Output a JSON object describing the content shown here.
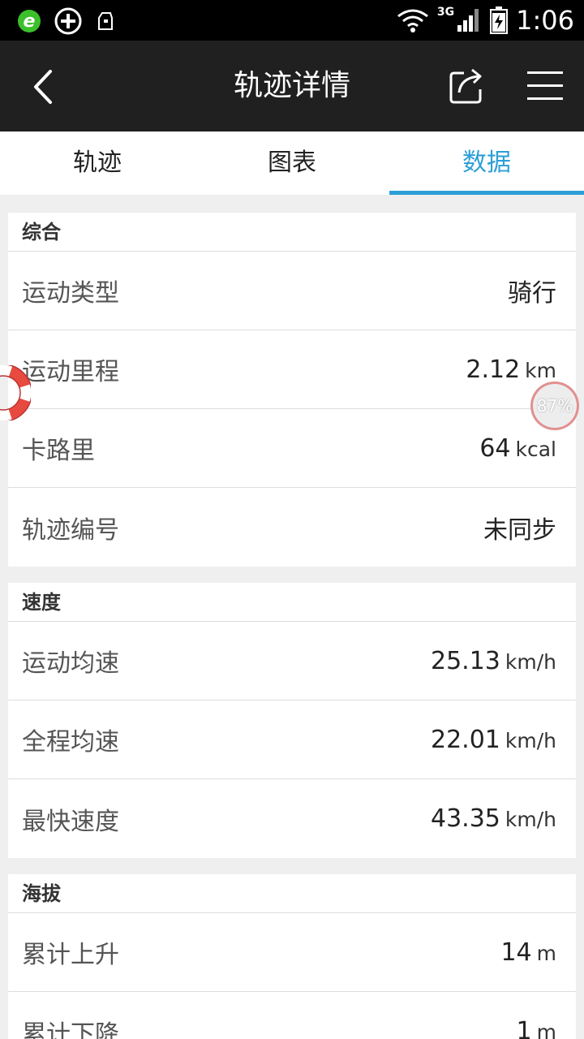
{
  "status_bar": {
    "time": "1:06",
    "network": "3G"
  },
  "app_bar": {
    "title": "轨迹详情"
  },
  "tabs": [
    {
      "label": "轨迹"
    },
    {
      "label": "图表"
    },
    {
      "label": "数据",
      "active": true
    }
  ],
  "sections": {
    "general": {
      "title": "综合",
      "rows": [
        {
          "label": "运动类型",
          "value": "骑行",
          "unit": ""
        },
        {
          "label": "运动里程",
          "value": "2.12",
          "unit": "km"
        },
        {
          "label": "卡路里",
          "value": "64",
          "unit": "kcal"
        },
        {
          "label": "轨迹编号",
          "value": "未同步",
          "unit": ""
        }
      ]
    },
    "speed": {
      "title": "速度",
      "rows": [
        {
          "label": "运动均速",
          "value": "25.13",
          "unit": "km/h"
        },
        {
          "label": "全程均速",
          "value": "22.01",
          "unit": "km/h"
        },
        {
          "label": "最快速度",
          "value": "43.35",
          "unit": "km/h"
        }
      ]
    },
    "altitude": {
      "title": "海拔",
      "rows": [
        {
          "label": "累计上升",
          "value": "14",
          "unit": "m"
        },
        {
          "label": "累计下降",
          "value": "1",
          "unit": "m"
        }
      ]
    }
  },
  "floating": {
    "battery_badge": "87%"
  },
  "colors": {
    "accent": "#2c9fd6",
    "appbar": "#202020"
  }
}
